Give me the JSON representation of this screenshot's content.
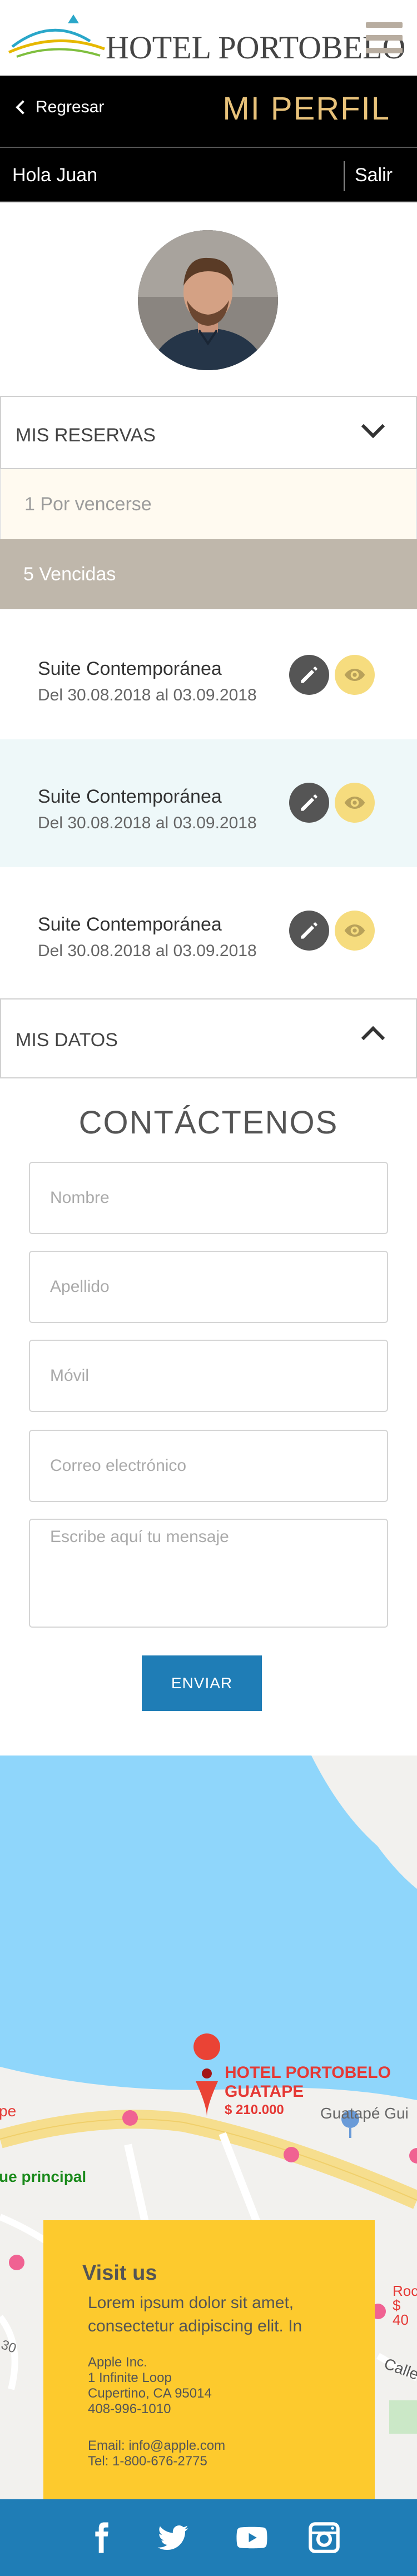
{
  "header": {
    "logo_text": "HOTEL PORTOBELO",
    "menu_icon": "hamburger-icon"
  },
  "profile_bar": {
    "back_label": "Regresar",
    "title": "MI PERFIL"
  },
  "user_bar": {
    "greeting": "Hola Juan",
    "logout_label": "Salir"
  },
  "reservations": {
    "section_label": "MIS RESERVAS",
    "expanded": true,
    "filters": [
      {
        "label": "1 Por vencerse"
      },
      {
        "label": "5 Vencidas"
      }
    ],
    "items": [
      {
        "title": "Suite Contemporánea",
        "dates": "Del 30.08.2018 al 03.09.2018"
      },
      {
        "title": "Suite Contemporánea",
        "dates": "Del 30.08.2018 al 03.09.2018"
      },
      {
        "title": "Suite Contemporánea",
        "dates": "Del 30.08.2018 al 03.09.2018"
      }
    ]
  },
  "my_data": {
    "section_label": "MIS DATOS"
  },
  "contact": {
    "title": "CONTÁCTENOS",
    "first_name_placeholder": "Nombre",
    "last_name_placeholder": "Apellido",
    "mobile_placeholder": "Móvil",
    "email_placeholder": "Correo electrónico",
    "message_placeholder": "Escribe aquí tu mensaje",
    "send_label": "ENVIAR"
  },
  "map": {
    "marker_name_line1": "HOTEL PORTOBELO",
    "marker_name_line2": "GUATAPE",
    "marker_price": "$ 210.000",
    "place_label": "Guatapé Gui",
    "road_label": "ue principal",
    "fragment_left": "pe",
    "fragment_street": "Calle",
    "fragment_number": "30",
    "fragment_right_top": "Roc",
    "fragment_right_bottom": "$ 40"
  },
  "info": {
    "heading": "Visit us",
    "lead": "Lorem ipsum dolor sit amet, consectetur adipiscing elit. In",
    "company": "Apple Inc.",
    "street": "1 Infinite Loop",
    "city": "Cupertino, CA 95014",
    "phone": "408-996-1010",
    "email_line": "Email: info@apple.com",
    "tel_line": "Tel: 1-800-676-2775"
  },
  "footer": {
    "social": [
      "facebook-icon",
      "twitter-icon",
      "youtube-icon",
      "instagram-icon"
    ]
  },
  "colors": {
    "gold": "#e8c27a",
    "blue": "#1f7db6",
    "yellow": "#fdca2d",
    "taupe": "#bfb7ab"
  }
}
